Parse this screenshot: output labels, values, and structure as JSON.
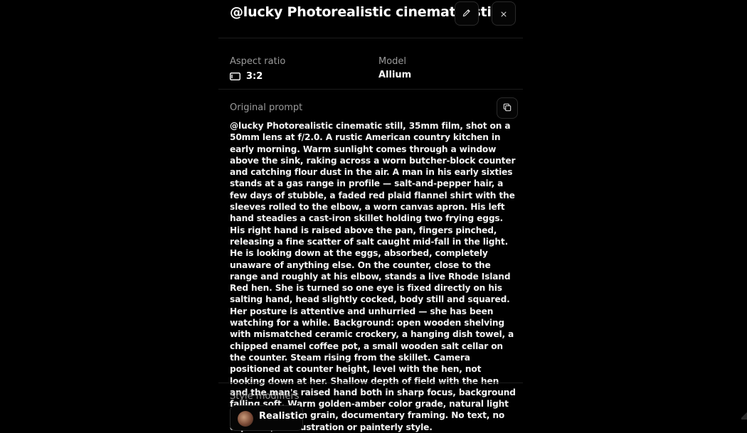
{
  "header": {
    "title": "@lucky Photorealistic cinematic still",
    "edit_icon": "pencil-icon",
    "close_icon": "close-icon"
  },
  "details": {
    "aspect_ratio_label": "Aspect ratio",
    "aspect_ratio_value": "3:2",
    "aspect_ratio_icon": "aspect-ratio-icon",
    "model_label": "Model",
    "model_value": "Allium"
  },
  "prompt": {
    "label": "Original prompt",
    "copy_icon": "copy-icon",
    "text": "@lucky Photorealistic cinematic still, 35mm film, shot on a 50mm lens at f/2.0. A rustic American country kitchen in early morning. Warm sunlight comes through a window above the sink, raking across a worn butcher-block counter and catching flour dust in the air. A man in his early sixties stands at a gas range in profile — salt-and-pepper hair, a few days of stubble, a faded red plaid flannel shirt with the sleeves rolled to the elbow, a worn canvas apron. His left hand steadies a cast-iron skillet holding two frying eggs. His right hand is raised above the pan, fingers pinched, releasing a fine scatter of salt caught mid-fall in the light. He is looking down at the eggs, absorbed, completely unaware of anything else. On the counter, close to the range and roughly at his elbow, stands a live Rhode Island Red hen. She is turned so one eye is fixed directly on his salting hand, head slightly cocked, body still and squared. Her posture is attentive and unhurried — she has been watching for a while. Background: open wooden shelving with mismatched ceramic crockery, a hanging dish towel, a chipped enamel coffee pot, a small wooden salt cellar on the counter. Steam rising from the skillet. Camera positioned at counter height, level with the hen, not looking down at her. Shallow depth of field with the hen and the man's raised hand both in sharp focus, background falling soft. Warm golden-amber color grade, natural light only, gentle film grain, documentary framing. No text, no captions, no illustration or painterly style."
  },
  "style_modifiers": {
    "label": "Style modifiers",
    "items": [
      {
        "label": "Realistic"
      }
    ]
  }
}
